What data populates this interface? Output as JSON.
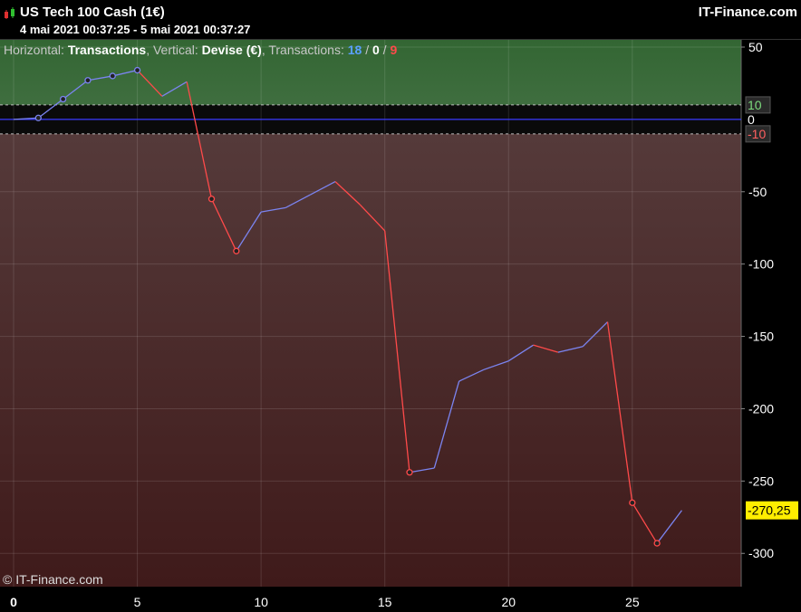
{
  "header": {
    "title": "US Tech 100 Cash (1€)",
    "date_range": "4 mai 2021 00:37:25 - 5 mai 2021 00:37:27",
    "brand": "IT-Finance.com"
  },
  "infobar": {
    "h_label": "Horizontal: ",
    "h_value": "Transactions",
    "v_label": ", Vertical: ",
    "v_value": "Devise (€)",
    "t_label": ", Transactions: ",
    "count_blue": "18",
    "sep1": " / ",
    "count_white": "0",
    "sep2": " / ",
    "count_red": "9"
  },
  "footer": {
    "copyright": "© IT-Finance.com"
  },
  "colors": {
    "up_zone": "#3b6b3b",
    "down_zone": "#4a2a28",
    "line_up": "#7b84f0",
    "line_down": "#ff4a4a",
    "zero_line": "#3a3aff",
    "current_value_bg": "#ffee00"
  },
  "chart_data": {
    "type": "line",
    "xlim": [
      0,
      29.4
    ],
    "ylim": [
      -323,
      55
    ],
    "x_ticks": [
      0,
      5,
      10,
      15,
      20,
      25
    ],
    "y_ticks": [
      50,
      -50,
      -100,
      -150,
      -200,
      -250,
      -300
    ],
    "threshold_labels": [
      {
        "value": 10,
        "label": "10",
        "color": "#7ddc7d"
      },
      {
        "value": 0,
        "label": "0",
        "color": "#ffffff"
      },
      {
        "value": -10,
        "label": "-10",
        "color": "#ff6060"
      }
    ],
    "current_value": {
      "value": -270.25,
      "label": "-270,25"
    },
    "points": [
      {
        "x": 0,
        "y": 0
      },
      {
        "x": 1,
        "y": 1
      },
      {
        "x": 2,
        "y": 14
      },
      {
        "x": 3,
        "y": 27
      },
      {
        "x": 4,
        "y": 30
      },
      {
        "x": 5,
        "y": 34
      },
      {
        "x": 6,
        "y": 16
      },
      {
        "x": 7,
        "y": 26
      },
      {
        "x": 8,
        "y": -55
      },
      {
        "x": 9,
        "y": -91
      },
      {
        "x": 10,
        "y": -64
      },
      {
        "x": 11,
        "y": -61
      },
      {
        "x": 12,
        "y": -52
      },
      {
        "x": 13,
        "y": -43
      },
      {
        "x": 14,
        "y": -59
      },
      {
        "x": 15,
        "y": -77
      },
      {
        "x": 16,
        "y": -244
      },
      {
        "x": 17,
        "y": -241
      },
      {
        "x": 18,
        "y": -181
      },
      {
        "x": 19,
        "y": -173
      },
      {
        "x": 20,
        "y": -167
      },
      {
        "x": 21,
        "y": -156
      },
      {
        "x": 22,
        "y": -161
      },
      {
        "x": 23,
        "y": -157
      },
      {
        "x": 24,
        "y": -140
      },
      {
        "x": 25,
        "y": -265
      },
      {
        "x": 26,
        "y": -293
      },
      {
        "x": 27,
        "y": -270.25
      }
    ],
    "markers": [
      {
        "x": 1,
        "kind": "up"
      },
      {
        "x": 2,
        "kind": "up"
      },
      {
        "x": 3,
        "kind": "up"
      },
      {
        "x": 4,
        "kind": "up"
      },
      {
        "x": 5,
        "kind": "up"
      },
      {
        "x": 8,
        "kind": "down"
      },
      {
        "x": 9,
        "kind": "down"
      },
      {
        "x": 16,
        "kind": "down"
      },
      {
        "x": 25,
        "kind": "down"
      },
      {
        "x": 26,
        "kind": "down"
      }
    ]
  }
}
